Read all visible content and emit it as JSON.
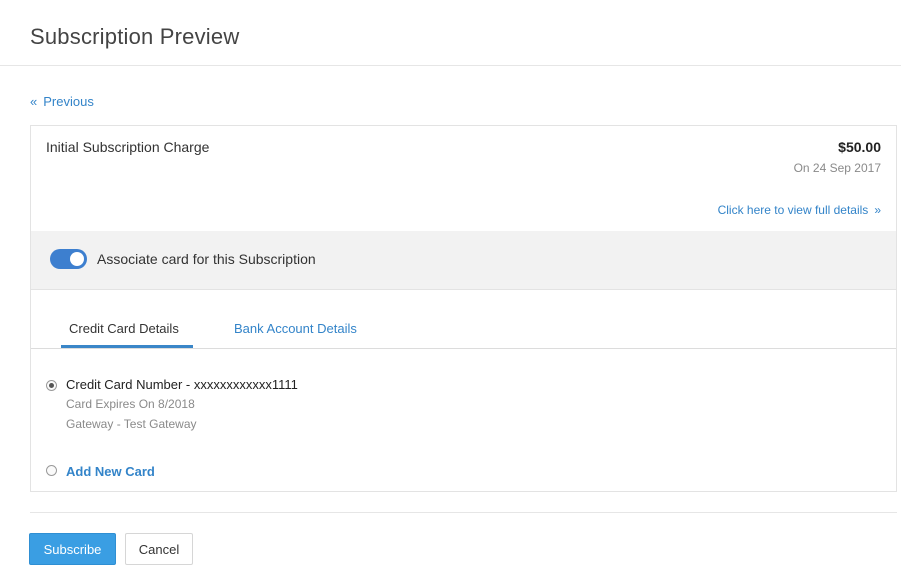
{
  "header": {
    "title": "Subscription Preview"
  },
  "nav": {
    "previous_icon": "«",
    "previous_label": "Previous"
  },
  "charge": {
    "label": "Initial Subscription Charge",
    "amount": "$50.00",
    "date": "On 24 Sep 2017",
    "details_link": "Click here to view full details",
    "details_icon": "»"
  },
  "associate_card": {
    "label": "Associate card for this Subscription",
    "enabled": true
  },
  "tabs": [
    {
      "label": "Credit Card Details",
      "active": true
    },
    {
      "label": "Bank Account Details",
      "active": false
    }
  ],
  "card": {
    "number": "Credit Card Number - xxxxxxxxxxxx1111",
    "expires": "Card Expires On 8/2018",
    "gateway": "Gateway - Test Gateway",
    "selected": true
  },
  "add_new_card": {
    "label": "Add New Card",
    "selected": false
  },
  "footer": {
    "subscribe_label": "Subscribe",
    "cancel_label": "Cancel"
  },
  "colors": {
    "accent": "#3384c9",
    "primary_button": "#3a9ee3",
    "toggle_on": "#3d7fcf"
  }
}
